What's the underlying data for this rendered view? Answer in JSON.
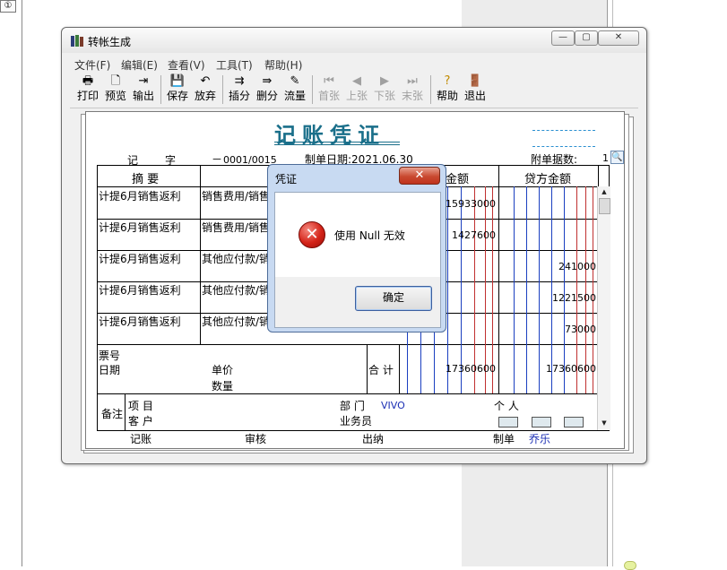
{
  "background": {
    "corner_icon": "①"
  },
  "window": {
    "title": "转帐生成",
    "icon": "books-icon",
    "controls": {
      "minimize": "—",
      "maximize": "▢",
      "close": "✕"
    }
  },
  "menu": [
    "文件(F)",
    "编辑(E)",
    "查看(V)",
    "工具(T)",
    "帮助(H)"
  ],
  "toolbar": {
    "print": "打印",
    "preview": "预览",
    "export": "输出",
    "save": "保存",
    "discard": "放弃",
    "insert_entry": "插分",
    "delete_entry": "删分",
    "cash_flow": "流量",
    "first": "首张",
    "prev": "上张",
    "next": "下张",
    "last": "末张",
    "help": "帮助",
    "exit": "退出"
  },
  "voucher": {
    "title": "记账凭证",
    "type_label": "记",
    "type_suffix": "字",
    "number": "0001/0015",
    "number_dash": "－",
    "date_label": "制单日期:2021.06.30",
    "attachments_label": "附单据数:",
    "attachments_value": "1",
    "headers": {
      "summary": "摘 要",
      "debit": "金额",
      "credit": "贷方金额"
    },
    "rows": [
      {
        "summary": "计提6月销售返利",
        "account": "销售费用/销售",
        "debit": "15933000",
        "credit": ""
      },
      {
        "summary": "计提6月销售返利",
        "account": "销售费用/销售",
        "debit": "1427600",
        "credit": ""
      },
      {
        "summary": "计提6月销售返利",
        "account": "其他应付款/销",
        "debit": "",
        "credit": "241000"
      },
      {
        "summary": "计提6月销售返利",
        "account": "其他应付款/销",
        "debit": "",
        "credit": "1221500"
      },
      {
        "summary": "计提6月销售返利",
        "account": "其他应付款/销",
        "debit": "",
        "credit": "73000"
      }
    ],
    "bill_no_label": "票号",
    "date_field_label": "日期",
    "unit_price_label": "单价",
    "quantity_label": "数量",
    "total_label": "合 计",
    "total_debit": "17360600",
    "total_credit": "17360600",
    "remark_label": "备注",
    "project_label": "项 目",
    "customer_label": "客 户",
    "department_label": "部 门",
    "department_value": "VIVO",
    "person_label": "个 人",
    "salesperson_label": "业务员",
    "footer": {
      "bookkeeper_label": "记账",
      "reviewer_label": "审核",
      "cashier_label": "出纳",
      "maker_label": "制单",
      "maker_value": "乔乐"
    }
  },
  "dialog": {
    "title": "凭证",
    "close": "✕",
    "icon": "error-icon",
    "message": "使用 Null 无效",
    "ok_label": "确定"
  },
  "colors": {
    "title_teal": "#1a6f8a",
    "dialog_frame": "#c8daf2",
    "close_red": "#c94a30",
    "error_red": "#d42318",
    "value_blue": "#1b2fb4"
  }
}
